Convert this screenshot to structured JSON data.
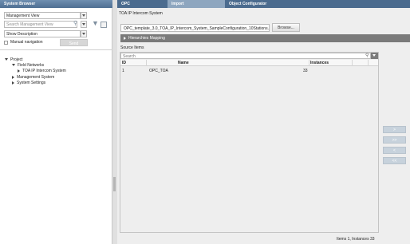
{
  "left": {
    "title": "System Browser",
    "view_combo": "Management View",
    "search_placeholder": "Search Management View",
    "description_combo": "Show Description",
    "manual_navigation": "Manual navigation",
    "send_button": "Send",
    "tree": [
      {
        "label": "Project",
        "expanded": true
      },
      {
        "label": "Field Networks",
        "expanded": true
      },
      {
        "label": "TOA IP Intercom System",
        "expanded": false
      },
      {
        "label": "Management System",
        "expanded": false
      },
      {
        "label": "System Settings",
        "expanded": false
      }
    ]
  },
  "tabs": [
    "OPC",
    "Import",
    "Object Configurator"
  ],
  "active_tab": "Import",
  "main": {
    "title": "TOA IP Intercom System",
    "file_path": "OPC_template_3.0_TOA_IP_Intercom_System_SampleConfiguration_10Stations.csv",
    "browse_button": "Browse...",
    "section": "Hierarchies Mapping",
    "source_items_label": "Source Items",
    "search_placeholder": "Search",
    "columns": [
      "ID",
      "",
      "Name",
      "Instances"
    ],
    "rows": [
      {
        "id": "1",
        "code": "OPC_TOA",
        "name": "",
        "instances": "33"
      }
    ],
    "side_buttons": [
      ">",
      ">>",
      "<",
      "<<"
    ],
    "status": "Items 1, Instances 33"
  },
  "colors": {
    "tab_bar": "#4b6b8e",
    "active_tab": "#8ea6bf",
    "section_bar": "#7a7a7a"
  }
}
